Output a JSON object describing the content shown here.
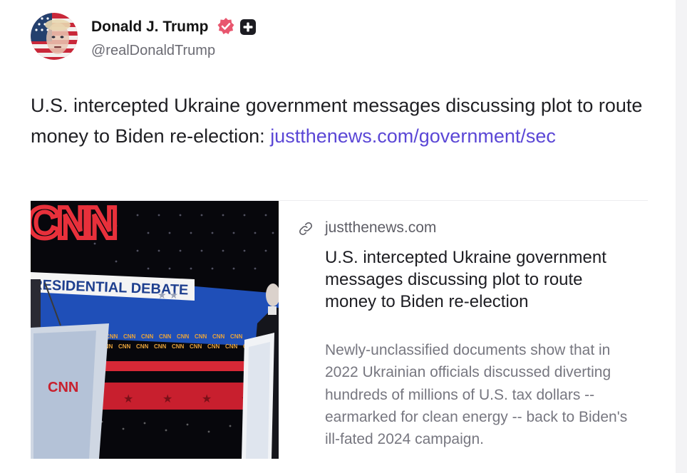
{
  "author": {
    "name": "Donald J. Trump",
    "handle": "@realDonaldTrump",
    "avatar_icon": "flag-portrait-avatar",
    "verified_color": "#e8566e"
  },
  "post": {
    "text_before_link": "U.S. intercepted Ukraine government messages discussing plot to route money to Biden re-election: ",
    "link_text": "justthenews.com/government/sec",
    "link_color": "#5b47d6"
  },
  "card": {
    "image_text": {
      "network": "CNN",
      "banner": "RESIDENTIAL DEBATE",
      "podium": "CNN"
    },
    "link_icon": "link-icon",
    "domain": "justthenews.com",
    "title": "U.S. intercepted Ukraine government messages discussing plot to route money to Biden re-election",
    "description": "Newly-unclassified documents show that in 2022 Ukrainian officials discussed diverting hundreds of millions of U.S. tax dollars -- earmarked for clean energy -- back to Biden's ill-fated 2024 campaign."
  }
}
